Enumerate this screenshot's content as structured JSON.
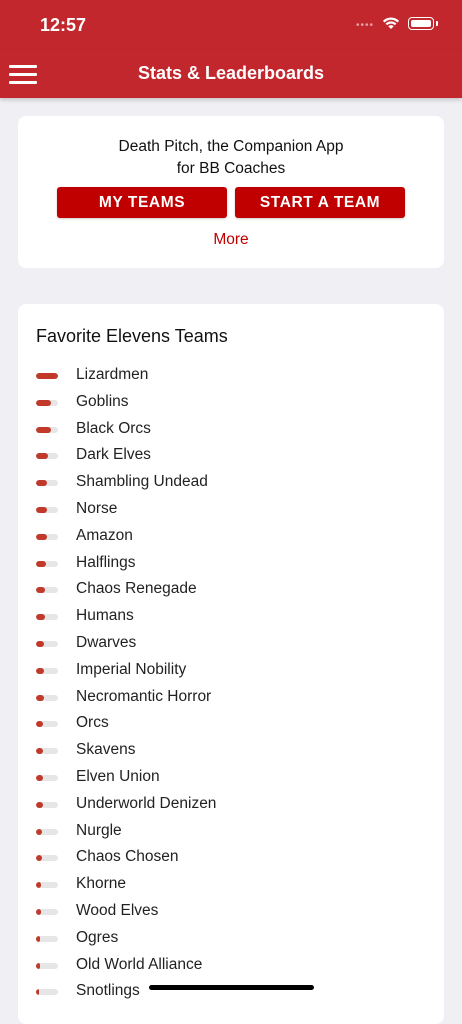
{
  "status": {
    "time": "12:57"
  },
  "nav": {
    "title": "Stats & Leaderboards"
  },
  "intro": {
    "line1": "Death Pitch, the Companion App",
    "line2": "for BB Coaches",
    "my_teams": "MY TEAMS",
    "start_team": "START A TEAM",
    "more": "More"
  },
  "favorites": {
    "title": "Favorite Elevens Teams",
    "teams": [
      {
        "name": "Lizardmen",
        "popularity": 1.0
      },
      {
        "name": "Goblins",
        "popularity": 0.7
      },
      {
        "name": "Black Orcs",
        "popularity": 0.68
      },
      {
        "name": "Dark Elves",
        "popularity": 0.55
      },
      {
        "name": "Shambling Undead",
        "popularity": 0.52
      },
      {
        "name": "Norse",
        "popularity": 0.5
      },
      {
        "name": "Amazon",
        "popularity": 0.48
      },
      {
        "name": "Halflings",
        "popularity": 0.46
      },
      {
        "name": "Chaos Renegade",
        "popularity": 0.42
      },
      {
        "name": "Humans",
        "popularity": 0.4
      },
      {
        "name": "Dwarves",
        "popularity": 0.38
      },
      {
        "name": "Imperial Nobility",
        "popularity": 0.36
      },
      {
        "name": "Necromantic Horror",
        "popularity": 0.35
      },
      {
        "name": "Orcs",
        "popularity": 0.33
      },
      {
        "name": "Skavens",
        "popularity": 0.32
      },
      {
        "name": "Elven Union",
        "popularity": 0.31
      },
      {
        "name": "Underworld Denizen",
        "popularity": 0.3
      },
      {
        "name": "Nurgle",
        "popularity": 0.29
      },
      {
        "name": "Chaos Chosen",
        "popularity": 0.28
      },
      {
        "name": "Khorne",
        "popularity": 0.24
      },
      {
        "name": "Wood Elves",
        "popularity": 0.22
      },
      {
        "name": "Ogres",
        "popularity": 0.18
      },
      {
        "name": "Old World Alliance",
        "popularity": 0.17
      },
      {
        "name": "Snotlings",
        "popularity": 0.15
      }
    ]
  },
  "colors": {
    "accent": "#c1272d",
    "button": "#c00000",
    "bar": "#c0392b"
  }
}
